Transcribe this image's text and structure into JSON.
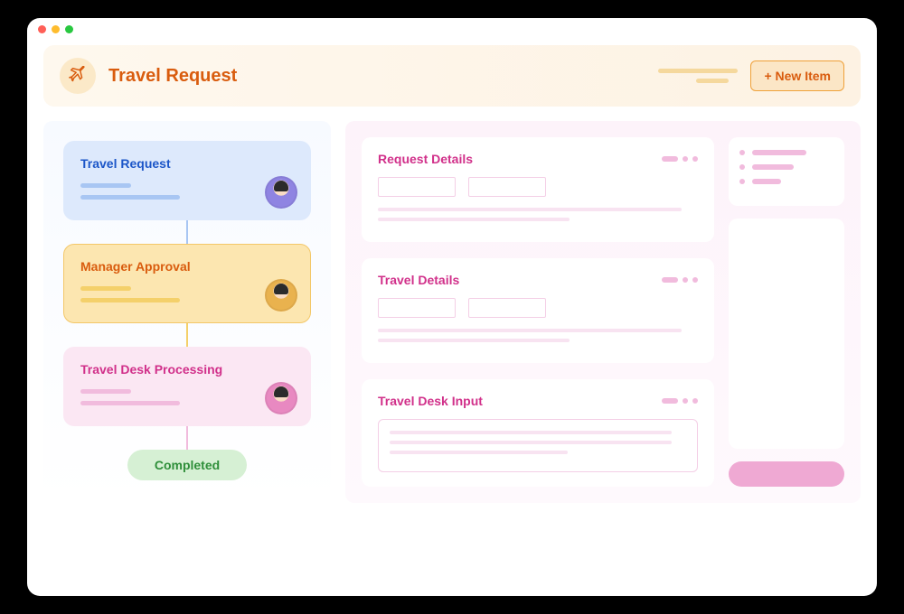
{
  "header": {
    "title": "Travel Request",
    "icon": "airplane-icon",
    "new_button": "+ New Item"
  },
  "workflow": {
    "steps": [
      {
        "title": "Travel Request",
        "style": "blue"
      },
      {
        "title": "Manager Approval",
        "style": "orange"
      },
      {
        "title": "Travel Desk Processing",
        "style": "pink"
      }
    ],
    "final_status": "Completed"
  },
  "details": {
    "panels": [
      {
        "title": "Request Details"
      },
      {
        "title": "Travel Details"
      },
      {
        "title": "Travel Desk Input"
      }
    ]
  }
}
